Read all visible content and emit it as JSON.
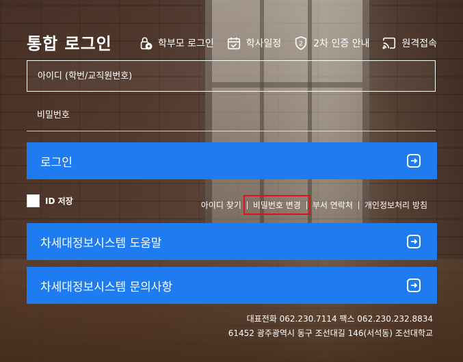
{
  "title": "통합 로그인",
  "top_links": [
    {
      "label": "학부모 로그인",
      "icon": "parent-lock-icon"
    },
    {
      "label": "학사일정",
      "icon": "calendar-check-icon"
    },
    {
      "label": "2차 인증 안내",
      "icon": "shield-2-icon"
    },
    {
      "label": "원격접속",
      "icon": "cast-icon"
    }
  ],
  "login": {
    "id_placeholder": "아이디 (학번/교직원번호)",
    "pw_placeholder": "비밀번호",
    "submit_label": "로그인"
  },
  "remember_id": {
    "label": "ID 저장",
    "checked": false
  },
  "links": [
    {
      "label": "아이디 찾기"
    },
    {
      "label": "비밀번호 변경"
    },
    {
      "label": "부서 연락처"
    },
    {
      "label": "개인정보처리 방침"
    }
  ],
  "help_buttons": [
    {
      "label": "차세대정보시스템 도움말"
    },
    {
      "label": "차세대정보시스템 문의사항"
    }
  ],
  "footer": {
    "line1": "대표전화 062.230.7114 팩스 062.230.232.8834",
    "line2": "61452 광주광역시 동구 조선대길 146(서석동) 조선대학교"
  },
  "colors": {
    "accent": "#1f7cf0",
    "highlight": "#e0111a"
  }
}
